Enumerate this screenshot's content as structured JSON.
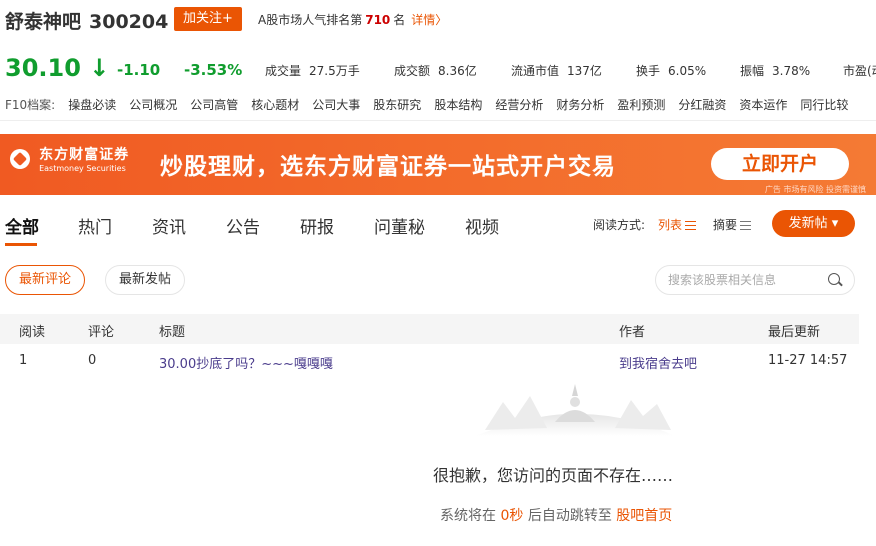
{
  "header": {
    "bar_name": "舒泰神吧",
    "code": "300204",
    "follow_label": "加关注+",
    "rank_prefix": "A股市场人气排名第",
    "rank_value": "710",
    "rank_suffix": "名",
    "details_label": "详情〉"
  },
  "quote": {
    "price": "30.10",
    "arrow": "↓",
    "change": "-1.10",
    "change_pct": "-3.53%",
    "stats": [
      {
        "label": "成交量",
        "value": "27.5万手"
      },
      {
        "label": "成交额",
        "value": "8.36亿"
      },
      {
        "label": "流通市值",
        "value": "137亿"
      },
      {
        "label": "换手",
        "value": "6.05%"
      },
      {
        "label": "振幅",
        "value": "3.78%"
      },
      {
        "label": "市盈(动)",
        "value": ""
      }
    ],
    "color_down": "#109d2e"
  },
  "f10": {
    "label": "F10档案:",
    "items": [
      "操盘必读",
      "公司概况",
      "公司高管",
      "核心题材",
      "公司大事",
      "股东研究",
      "股本结构",
      "经营分析",
      "财务分析",
      "盈利预测",
      "分红融资",
      "资本运作",
      "同行比较"
    ]
  },
  "banner": {
    "logo_cn": "东方财富证券",
    "logo_en": "Eastmoney Securities",
    "slogan": "炒股理财，选东方财富证券一站式开户交易",
    "button": "立即开户",
    "ad_note": "广告 市场有风险 投资需谨慎",
    "accent": "#f05a22"
  },
  "tabs": [
    "全部",
    "热门",
    "资讯",
    "公告",
    "研报",
    "问董秘",
    "视频"
  ],
  "read_mode": {
    "label": "阅读方式:",
    "list": "列表",
    "summary": "摘要"
  },
  "new_post": "发新帖 ▾",
  "filters": {
    "latest_comment": "最新评论",
    "latest_post": "最新发帖"
  },
  "search": {
    "placeholder": "搜索该股票相关信息"
  },
  "table": {
    "headers": {
      "reads": "阅读",
      "comments": "评论",
      "title": "标题",
      "author": "作者",
      "updated": "最后更新"
    },
    "rows": [
      {
        "reads": "1",
        "comments": "0",
        "title": "30.00抄底了吗？~~~嘎嘎嘎",
        "author": "到我宿舍去吧",
        "updated": "11-27 14:57"
      }
    ]
  },
  "empty": {
    "message": "很抱歉，您访问的页面不存在……",
    "redirect_prefix": "系统将在",
    "seconds": "0秒",
    "redirect_mid": "后自动跳转至",
    "home_link": "股吧首页"
  },
  "brand_color": "#ea5504"
}
